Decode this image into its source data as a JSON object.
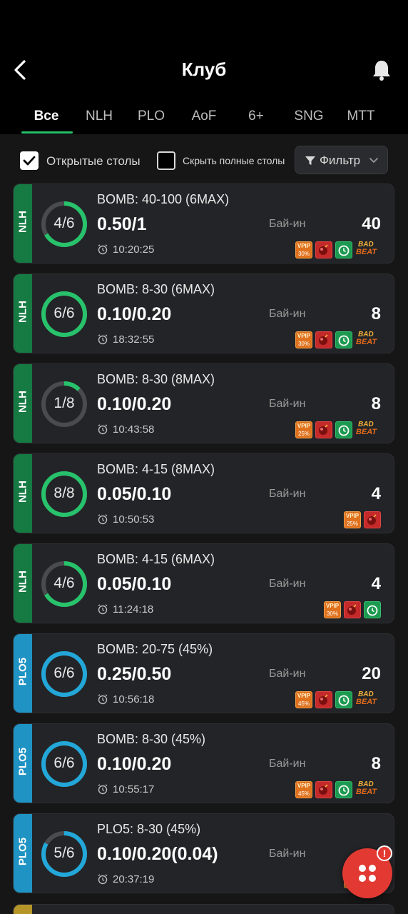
{
  "header": {
    "title": "Клуб"
  },
  "tabs": [
    "Все",
    "NLH",
    "PLO",
    "AoF",
    "6+",
    "SNG",
    "MTT"
  ],
  "filters": {
    "open_tables_label": "Открытые столы",
    "hide_full_label": "Скрыть полные столы",
    "filter_label": "Фильтр"
  },
  "tables": [
    {
      "game": "NLH",
      "seats": "4/6",
      "fill": 0.667,
      "name": "BOMB: 40-100 (6MAX)",
      "blinds": "0.50/1",
      "time": "10:20:25",
      "buyin_label": "Бай-ин",
      "buyin": "40",
      "vpip": "30%",
      "badges": [
        "vpip",
        "bomb",
        "alarm",
        "badbeat"
      ]
    },
    {
      "game": "NLH",
      "seats": "6/6",
      "fill": 1,
      "name": "BOMB: 8-30 (6MAX)",
      "blinds": "0.10/0.20",
      "time": "18:32:55",
      "buyin_label": "Бай-ин",
      "buyin": "8",
      "vpip": "30%",
      "badges": [
        "vpip",
        "bomb",
        "alarm",
        "badbeat"
      ]
    },
    {
      "game": "NLH",
      "seats": "1/8",
      "fill": 0.125,
      "name": "BOMB: 8-30 (8MAX)",
      "blinds": "0.10/0.20",
      "time": "10:43:58",
      "buyin_label": "Бай-ин",
      "buyin": "8",
      "vpip": "25%",
      "badges": [
        "vpip",
        "bomb",
        "alarm",
        "badbeat"
      ]
    },
    {
      "game": "NLH",
      "seats": "8/8",
      "fill": 1,
      "name": "BOMB: 4-15 (8MAX)",
      "blinds": "0.05/0.10",
      "time": "10:50:53",
      "buyin_label": "Бай-ин",
      "buyin": "4",
      "vpip": "25%",
      "badges": [
        "vpip",
        "bomb"
      ]
    },
    {
      "game": "NLH",
      "seats": "4/6",
      "fill": 0.667,
      "name": "BOMB: 4-15 (6MAX)",
      "blinds": "0.05/0.10",
      "time": "11:24:18",
      "buyin_label": "Бай-ин",
      "buyin": "4",
      "vpip": "30%",
      "badges": [
        "vpip",
        "bomb",
        "alarm"
      ]
    },
    {
      "game": "PLO5",
      "seats": "6/6",
      "fill": 1,
      "name": "BOMB: 20-75 (45%)",
      "blinds": "0.25/0.50",
      "time": "10:56:18",
      "buyin_label": "Бай-ин",
      "buyin": "20",
      "vpip": "45%",
      "badges": [
        "vpip",
        "bomb",
        "alarm",
        "badbeat"
      ]
    },
    {
      "game": "PLO5",
      "seats": "6/6",
      "fill": 1,
      "name": "BOMB: 8-30 (45%)",
      "blinds": "0.10/0.20",
      "time": "10:55:17",
      "buyin_label": "Бай-ин",
      "buyin": "8",
      "vpip": "45%",
      "badges": [
        "vpip",
        "bomb",
        "alarm",
        "badbeat"
      ]
    },
    {
      "game": "PLO5",
      "seats": "5/6",
      "fill": 0.833,
      "name": "PLO5: 8-30 (45%)",
      "blinds": "0.10/0.20(0.04)",
      "time": "20:37:19",
      "buyin_label": "Бай-ин",
      "buyin": "",
      "vpip": "45%",
      "badges": [
        "vpip",
        "bomb"
      ]
    }
  ],
  "badge_text": {
    "vpip": "VPIP",
    "badbeat_top": "BAD",
    "badbeat_bottom": "BEAT"
  },
  "fab_alert": "!",
  "colors": {
    "nlh": "#167a43",
    "plo": "#1f93c3",
    "accent": "#27c26b",
    "fab": "#e23a33"
  }
}
